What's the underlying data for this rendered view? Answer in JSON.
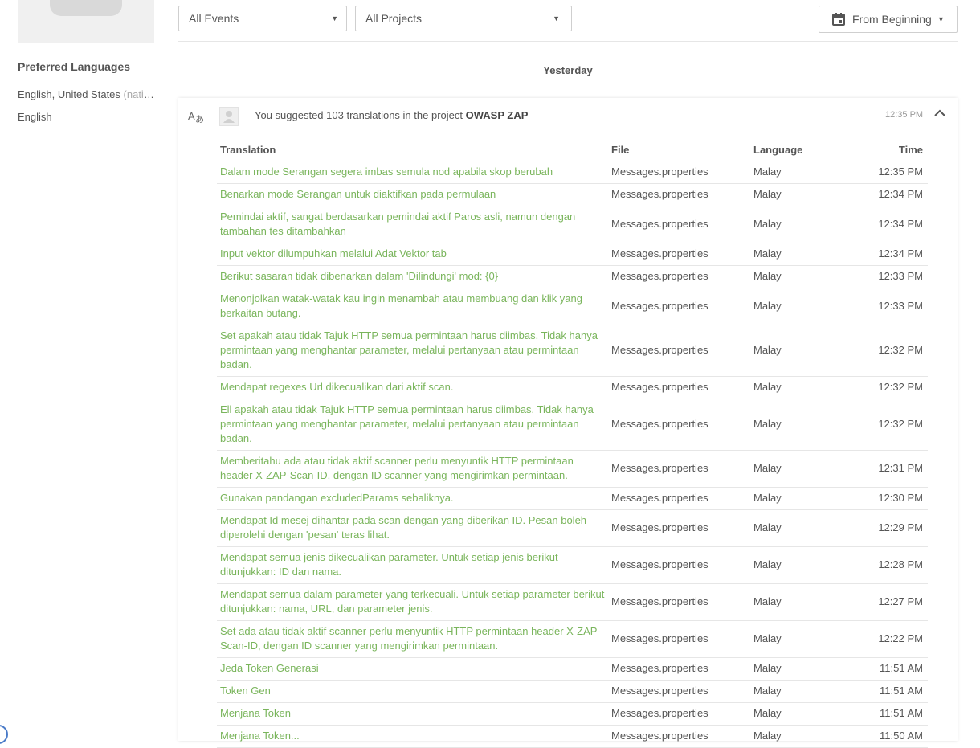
{
  "sidebar": {
    "preferred_languages_title": "Preferred Languages",
    "languages": [
      {
        "name": "English, United States",
        "note": "(native)"
      },
      {
        "name": "English",
        "note": ""
      }
    ]
  },
  "filters": {
    "events": "All Events",
    "projects": "All Projects",
    "date_range": "From Beginning"
  },
  "day_header": "Yesterday",
  "event": {
    "summary_prefix": "You suggested 103 translations in the project",
    "project": "OWASP ZAP",
    "time": "12:35 PM"
  },
  "table": {
    "headers": [
      "Translation",
      "File",
      "Language",
      "Time"
    ],
    "rows": [
      {
        "translation": "Dalam mode Serangan segera imbas semula nod apabila skop berubah",
        "file": "Messages.properties",
        "language": "Malay",
        "time": "12:35 PM"
      },
      {
        "translation": "Benarkan mode Serangan untuk diaktifkan pada permulaan",
        "file": "Messages.properties",
        "language": "Malay",
        "time": "12:34 PM"
      },
      {
        "translation": "Pemindai aktif, sangat berdasarkan pemindai aktif Paros asli, namun dengan tambahan tes ditambahkan",
        "file": "Messages.properties",
        "language": "Malay",
        "time": "12:34 PM"
      },
      {
        "translation": "Input vektor dilumpuhkan melalui Adat Vektor tab",
        "file": "Messages.properties",
        "language": "Malay",
        "time": "12:34 PM"
      },
      {
        "translation": "Berikut sasaran tidak dibenarkan dalam 'Dilindungi' mod: {0}",
        "file": "Messages.properties",
        "language": "Malay",
        "time": "12:33 PM"
      },
      {
        "translation": "Menonjolkan watak-watak kau ingin menambah atau membuang dan klik yang berkaitan butang.",
        "file": "Messages.properties",
        "language": "Malay",
        "time": "12:33 PM"
      },
      {
        "translation": "Set apakah atau tidak Tajuk HTTP semua permintaan harus diimbas. Tidak hanya permintaan yang menghantar parameter, melalui pertanyaan atau permintaan badan.",
        "file": "Messages.properties",
        "language": "Malay",
        "time": "12:32 PM"
      },
      {
        "translation": "Mendapat regexes Url dikecualikan dari aktif scan.",
        "file": "Messages.properties",
        "language": "Malay",
        "time": "12:32 PM"
      },
      {
        "translation": "Ell apakah atau tidak Tajuk HTTP semua permintaan harus diimbas. Tidak hanya permintaan yang menghantar parameter, melalui pertanyaan atau permintaan badan.",
        "file": "Messages.properties",
        "language": "Malay",
        "time": "12:32 PM"
      },
      {
        "translation": "Memberitahu ada atau tidak aktif scanner perlu menyuntik HTTP permintaan header X-ZAP-Scan-ID, dengan ID scanner yang mengirimkan permintaan.",
        "file": "Messages.properties",
        "language": "Malay",
        "time": "12:31 PM"
      },
      {
        "translation": "Gunakan pandangan excludedParams sebaliknya.",
        "file": "Messages.properties",
        "language": "Malay",
        "time": "12:30 PM"
      },
      {
        "translation": "Mendapat Id mesej dihantar pada scan dengan yang diberikan ID. Pesan boleh diperolehi dengan 'pesan' teras lihat.",
        "file": "Messages.properties",
        "language": "Malay",
        "time": "12:29 PM"
      },
      {
        "translation": "Mendapat semua jenis dikecualikan parameter. Untuk setiap jenis berikut ditunjukkan: ID dan nama.",
        "file": "Messages.properties",
        "language": "Malay",
        "time": "12:28 PM"
      },
      {
        "translation": "Mendapat semua dalam parameter yang terkecuali. Untuk setiap parameter berikut ditunjukkan: nama, URL, dan parameter jenis.",
        "file": "Messages.properties",
        "language": "Malay",
        "time": "12:27 PM"
      },
      {
        "translation": "Set ada atau tidak aktif scanner perlu menyuntik HTTP permintaan header X-ZAP-Scan-ID, dengan ID scanner yang mengirimkan permintaan.",
        "file": "Messages.properties",
        "language": "Malay",
        "time": "12:22 PM"
      },
      {
        "translation": "Jeda Token Generasi",
        "file": "Messages.properties",
        "language": "Malay",
        "time": "11:51 AM"
      },
      {
        "translation": "Token Gen",
        "file": "Messages.properties",
        "language": "Malay",
        "time": "11:51 AM"
      },
      {
        "translation": "Menjana Token",
        "file": "Messages.properties",
        "language": "Malay",
        "time": "11:51 AM"
      },
      {
        "translation": "Menjana Token...",
        "file": "Messages.properties",
        "language": "Malay",
        "time": "11:50 AM"
      }
    ]
  },
  "colors": {
    "translation_link": "#7ab55c",
    "text": "#555555",
    "muted": "#aaaaaa"
  },
  "icons": [
    "translate-icon",
    "user-avatar-icon",
    "calendar-icon",
    "chevron-up-icon",
    "chevron-down-icon"
  ]
}
